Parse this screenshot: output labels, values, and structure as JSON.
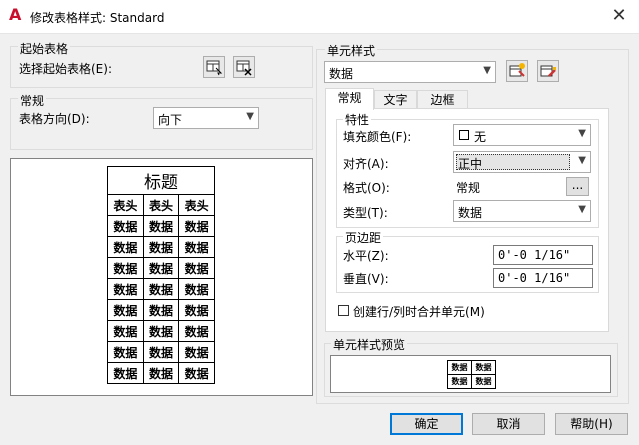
{
  "window": {
    "title": "修改表格样式: Standard",
    "close": "✕"
  },
  "start_table": {
    "group": "起始表格",
    "select_label": "选择起始表格(E):"
  },
  "general": {
    "group": "常规",
    "direction_label": "表格方向(D):",
    "direction_value": "向下"
  },
  "preview_table": {
    "title": "标题",
    "header": [
      "表头",
      "表头",
      "表头"
    ],
    "rows": [
      [
        "数据",
        "数据",
        "数据"
      ],
      [
        "数据",
        "数据",
        "数据"
      ],
      [
        "数据",
        "数据",
        "数据"
      ],
      [
        "数据",
        "数据",
        "数据"
      ],
      [
        "数据",
        "数据",
        "数据"
      ],
      [
        "数据",
        "数据",
        "数据"
      ],
      [
        "数据",
        "数据",
        "数据"
      ],
      [
        "数据",
        "数据",
        "数据"
      ]
    ]
  },
  "cell_style": {
    "group": "单元样式",
    "selected": "数据",
    "tabs": [
      "常规",
      "文字",
      "边框"
    ],
    "properties": {
      "group": "特性",
      "fill_color_label": "填充颜色(F):",
      "fill_color_value": "无",
      "align_label": "对齐(A):",
      "align_value": "正中",
      "format_label": "格式(O):",
      "format_value": "常规",
      "format_button": "...",
      "type_label": "类型(T):",
      "type_value": "数据"
    },
    "margins": {
      "group": "页边距",
      "horizontal_label": "水平(Z):",
      "horizontal_value": "0'-0 1/16\"",
      "vertical_label": "垂直(V):",
      "vertical_value": "0'-0 1/16\""
    },
    "merge_label": "创建行/列时合并单元(M)",
    "merge_checked": false
  },
  "cell_preview": {
    "group": "单元样式预览",
    "cells": [
      [
        "数据",
        "数据"
      ],
      [
        "数据",
        "数据"
      ]
    ]
  },
  "buttons": {
    "ok": "确定",
    "cancel": "取消",
    "help": "帮助(H)"
  }
}
